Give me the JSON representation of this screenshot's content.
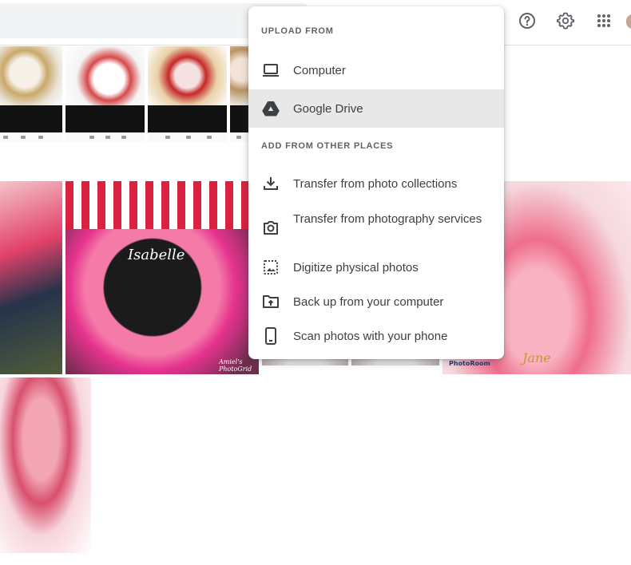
{
  "menu": {
    "upload_header": "UPLOAD FROM",
    "computer": "Computer",
    "google_drive": "Google Drive",
    "other_header": "ADD FROM OTHER PLACES",
    "transfer_collections": "Transfer from photo collections",
    "transfer_services": "Transfer from photography services",
    "digitize": "Digitize physical photos",
    "backup": "Back up from your computer",
    "scan": "Scan photos with your phone"
  },
  "icons": {
    "help": "help-circle-icon",
    "settings": "gear-icon",
    "apps": "apps-grid-icon"
  },
  "colors": {
    "menu_active_bg": "#e8e8e8",
    "text": "#3c4043",
    "muted": "#5f6368"
  },
  "photos": {
    "caption_isabelle": "Isabelle",
    "watermark_amiel": "Amiel's PhotoGrid",
    "watermark_photoroom": "PhotoRoom",
    "caption_jane": "Jane"
  }
}
